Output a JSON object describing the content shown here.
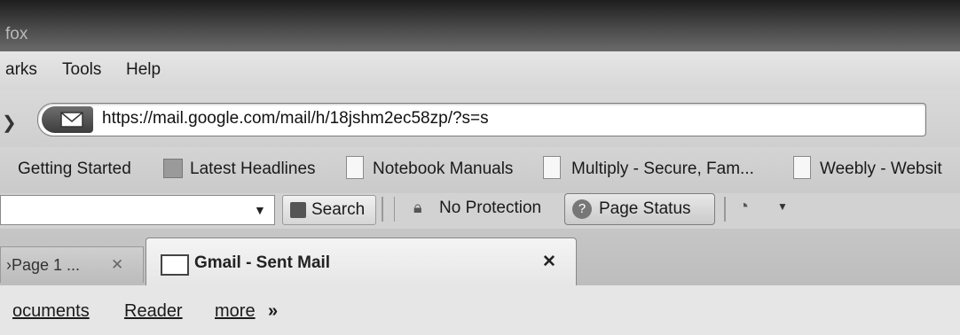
{
  "window": {
    "title": "fox"
  },
  "menubar": {
    "items": [
      "arks",
      "Tools",
      "Help"
    ]
  },
  "navbar": {
    "url": "https://mail.google.com/mail/h/18jshm2ec58zp/?s=s"
  },
  "bookmarks": {
    "items": [
      "Getting Started",
      "Latest Headlines",
      "Notebook Manuals",
      "Multiply - Secure, Fam...",
      "Weebly - Websit"
    ]
  },
  "toolbar": {
    "search_label": "Search",
    "protection_label": "No Protection",
    "page_status_label": "Page Status"
  },
  "tabs": {
    "inactive_label": "Page 1 ...",
    "active_label": "Gmail - Sent Mail"
  },
  "content": {
    "links": [
      "ocuments",
      "Reader",
      "more"
    ],
    "more_suffix": "»"
  }
}
